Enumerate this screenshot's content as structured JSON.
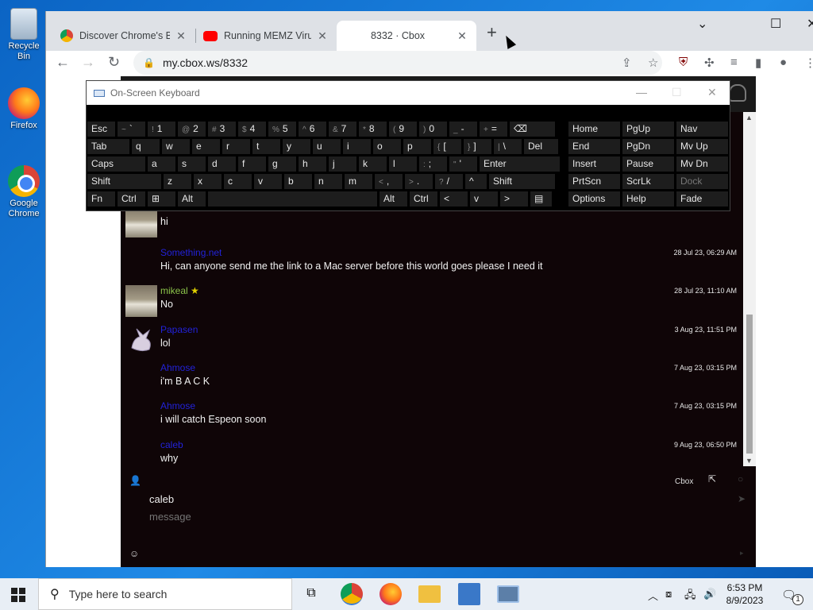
{
  "desktop": {
    "icons": [
      {
        "label": "Recycle Bin"
      },
      {
        "label": "Firefox"
      },
      {
        "label": "Google Chrome"
      }
    ]
  },
  "browser": {
    "tabs": [
      {
        "title": "Discover Chrome's Bu",
        "favicon": "chrome-icon"
      },
      {
        "title": "Running MEMZ Virus",
        "favicon": "youtube-icon"
      },
      {
        "title": "8332 · Cbox",
        "favicon": ""
      }
    ],
    "url": "my.cbox.ws/8332",
    "accent_color": "#8bc34a"
  },
  "osk": {
    "title": "On-Screen Keyboard",
    "rows": [
      [
        [
          "Esc"
        ],
        [
          "~",
          "`"
        ],
        [
          "!",
          "1"
        ],
        [
          "@",
          "2"
        ],
        [
          "#",
          "3"
        ],
        [
          "$",
          "4"
        ],
        [
          "%",
          "5"
        ],
        [
          "^",
          "6"
        ],
        [
          "&",
          "7"
        ],
        [
          "*",
          "8"
        ],
        [
          "(",
          "9"
        ],
        [
          ")",
          "0"
        ],
        [
          "_",
          "-"
        ],
        [
          "+",
          "="
        ],
        [
          "⌫"
        ],
        [
          "Home"
        ],
        [
          "PgUp"
        ],
        [
          "Nav"
        ]
      ],
      [
        [
          "Tab"
        ],
        [
          "q"
        ],
        [
          "w"
        ],
        [
          "e"
        ],
        [
          "r"
        ],
        [
          "t"
        ],
        [
          "y"
        ],
        [
          "u"
        ],
        [
          "i"
        ],
        [
          "o"
        ],
        [
          "p"
        ],
        [
          "{",
          "["
        ],
        [
          "}",
          "]"
        ],
        [
          "|",
          "\\"
        ],
        [
          "Del"
        ],
        [
          "End"
        ],
        [
          "PgDn"
        ],
        [
          "Mv Up"
        ]
      ],
      [
        [
          "Caps"
        ],
        [
          "a"
        ],
        [
          "s"
        ],
        [
          "d"
        ],
        [
          "f"
        ],
        [
          "g"
        ],
        [
          "h"
        ],
        [
          "j"
        ],
        [
          "k"
        ],
        [
          "l"
        ],
        [
          ":",
          ";"
        ],
        [
          "\"",
          "'"
        ],
        [
          "Enter"
        ],
        [
          "Insert"
        ],
        [
          "Pause"
        ],
        [
          "Mv Dn"
        ]
      ],
      [
        [
          "Shift"
        ],
        [
          "z"
        ],
        [
          "x"
        ],
        [
          "c"
        ],
        [
          "v"
        ],
        [
          "b"
        ],
        [
          "n"
        ],
        [
          "m"
        ],
        [
          "<",
          ","
        ],
        [
          ">",
          "."
        ],
        [
          "?",
          "/"
        ],
        [
          "^"
        ],
        [
          "Shift"
        ],
        [
          "PrtScn"
        ],
        [
          "ScrLk"
        ],
        [
          "Dock"
        ]
      ],
      [
        [
          "Fn"
        ],
        [
          "Ctrl"
        ],
        [
          "⊞"
        ],
        [
          "Alt"
        ],
        [
          ""
        ],
        [
          "Alt"
        ],
        [
          "Ctrl"
        ],
        [
          "<"
        ],
        [
          "v"
        ],
        [
          ">"
        ],
        [
          "▤"
        ],
        [
          "Options"
        ],
        [
          "Help"
        ],
        [
          "Fade"
        ]
      ]
    ]
  },
  "chat": {
    "messages": [
      {
        "name": "",
        "time": "",
        "text": "hi",
        "avatar": "photo"
      },
      {
        "name": "Something.net",
        "time": "28 Jul 23, 06:29 AM",
        "text": "Hi, can anyone send me the link to a Mac server before this world goes please I need it",
        "avatar": ""
      },
      {
        "name": "mikeal",
        "time": "28 Jul 23, 11:10 AM",
        "text": "No",
        "avatar": "photo"
      },
      {
        "name": "Papasen",
        "time": "3 Aug 23, 11:51 PM",
        "text": "lol",
        "avatar": "espeon"
      },
      {
        "name": "Ahmose",
        "time": "7 Aug 23, 03:15 PM",
        "text": "i'm B A C K",
        "avatar": ""
      },
      {
        "name": "Ahmose",
        "time": "7 Aug 23, 03:15 PM",
        "text": "i will catch Espeon soon",
        "avatar": ""
      },
      {
        "name": "caleb",
        "time": "9 Aug 23, 06:50 PM",
        "text": "why",
        "avatar": ""
      }
    ],
    "cbox_label": "Cbox",
    "username": "caleb",
    "message_placeholder": "message"
  },
  "taskbar": {
    "search_placeholder": "Type here to search",
    "time": "6:53 PM",
    "date": "8/9/2023",
    "notification_count": "1"
  }
}
